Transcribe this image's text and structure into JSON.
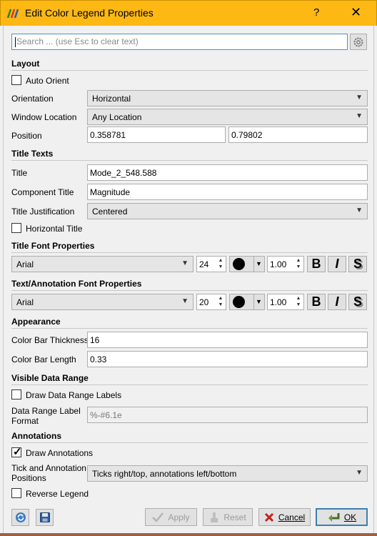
{
  "window": {
    "title": "Edit Color Legend Properties",
    "help": "?",
    "close": "✕"
  },
  "search": {
    "placeholder": "Search ... (use Esc to clear text)"
  },
  "layout": {
    "heading": "Layout",
    "auto_orient": {
      "label": "Auto Orient",
      "checked": false
    },
    "orientation": {
      "label": "Orientation",
      "value": "Horizontal"
    },
    "window_location": {
      "label": "Window Location",
      "value": "Any Location"
    },
    "position": {
      "label": "Position",
      "x": "0.358781",
      "y": "0.79802"
    }
  },
  "title_texts": {
    "heading": "Title Texts",
    "title": {
      "label": "Title",
      "value": "Mode_2_548.588"
    },
    "component_title": {
      "label": "Component Title",
      "value": "Magnitude"
    },
    "title_justification": {
      "label": "Title Justification",
      "value": "Centered"
    },
    "horizontal_title": {
      "label": "Horizontal Title",
      "checked": false
    }
  },
  "title_font": {
    "heading": "Title Font Properties",
    "family": "Arial",
    "size": "24",
    "opacity": "1.00",
    "bold": "B",
    "italic": "I",
    "shadow": "S"
  },
  "annotation_font": {
    "heading": "Text/Annotation Font Properties",
    "family": "Arial",
    "size": "20",
    "opacity": "1.00",
    "bold": "B",
    "italic": "I",
    "shadow": "S"
  },
  "appearance": {
    "heading": "Appearance",
    "thickness": {
      "label": "Color Bar Thickness",
      "value": "16"
    },
    "length": {
      "label": "Color Bar Length",
      "value": "0.33"
    }
  },
  "visible_range": {
    "heading": "Visible Data Range",
    "draw_labels": {
      "label": "Draw Data Range Labels",
      "checked": false
    },
    "format": {
      "label_line1": "Data Range Label",
      "label_line2": "Format",
      "value": "%-#6.1e"
    }
  },
  "annotations": {
    "heading": "Annotations",
    "draw": {
      "label": "Draw Annotations",
      "checked": true
    },
    "positions": {
      "label_line1": "Tick and Annotation",
      "label_line2": "Positions",
      "value": "Ticks right/top, annotations left/bottom"
    },
    "reverse": {
      "label": "Reverse Legend",
      "checked": false
    }
  },
  "buttons": {
    "apply": "Apply",
    "reset": "Reset",
    "cancel": "Cancel",
    "ok": "OK"
  }
}
